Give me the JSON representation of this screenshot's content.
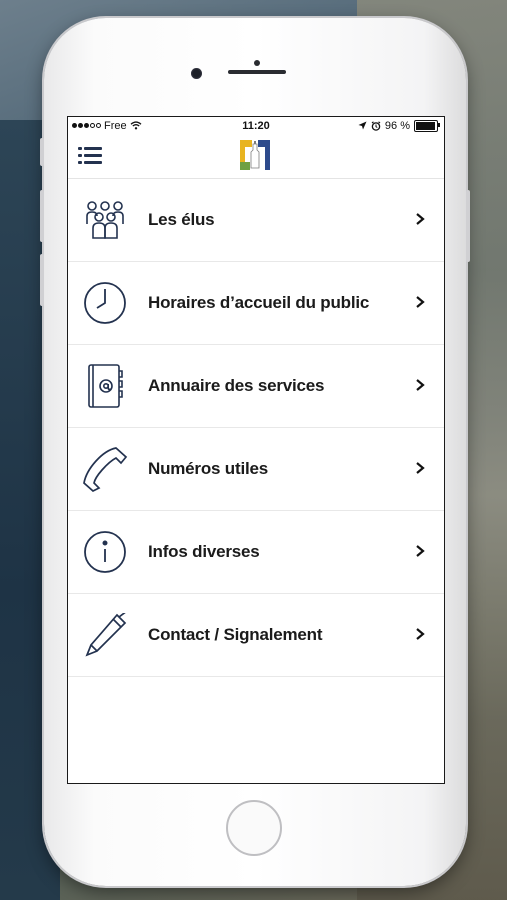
{
  "status_bar": {
    "carrier": "Free",
    "time": "11:20",
    "battery": "96 %",
    "battery_level": 0.96
  },
  "nav": {
    "menu_icon": "list-menu-icon",
    "logo_icon": "municipal-logo-icon"
  },
  "menu": [
    {
      "label": "Les élus",
      "icon": "people-group-icon"
    },
    {
      "label": "Horaires d’accueil du public",
      "icon": "clock-icon"
    },
    {
      "label": "Annuaire des services",
      "icon": "address-book-icon"
    },
    {
      "label": "Numéros utiles",
      "icon": "phone-handset-icon"
    },
    {
      "label": "Infos diverses",
      "icon": "info-icon"
    },
    {
      "label": "Contact / Signalement",
      "icon": "pen-icon"
    }
  ],
  "colors": {
    "icon_stroke": "#23324f",
    "logo_yellow": "#e8b420",
    "logo_blue": "#2d4a8c",
    "logo_green": "#6fa043"
  }
}
